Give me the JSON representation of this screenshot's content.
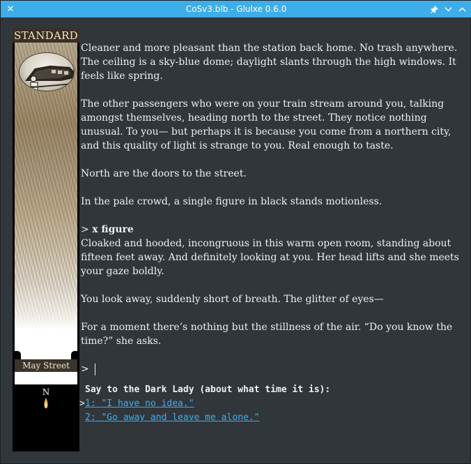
{
  "window": {
    "title": "CoSv3.blb - Glulxe 0.6.0"
  },
  "titlebar_icons": {
    "close": "close-icon",
    "pin": "pin-icon",
    "minimize": "chevron-down-icon",
    "maximize": "chevron-up-icon"
  },
  "sidebar": {
    "header": "STANDARD",
    "location": "May Street",
    "compass_label": "N"
  },
  "story": {
    "paragraphs": [
      "Cleaner and more pleasant than the station back home. No trash anywhere. The ceiling is a sky-blue dome; daylight slants through the high windows. It feels like spring.",
      "The other passengers who were on your train stream around you, talking amongst themselves, heading north to the street. They notice nothing unusual. To you— but perhaps it is because you come from a northern city, and this quality of light is strange to you. Real enough to taste.",
      "North are the doors to the street.",
      "In the pale crowd, a single figure in black stands motionless."
    ],
    "command_prompt": ">",
    "command": "x figure",
    "response_paragraphs": [
      "Cloaked and hooded, incongruous in this warm open room, standing about fifteen feet away. And definitely looking at you. Her head lifts and she meets your gaze boldly.",
      "You look away, suddenly short of breath. The glitter of eyes—",
      "For a moment there’s nothing but the stillness of the air. “Do you know the time?” she asks."
    ],
    "input_prompt": ">"
  },
  "menu": {
    "heading": "Say to the Dark Lady (about what time it is):",
    "marker": ">",
    "options": [
      "1: \"I have no idea.\"",
      "2: \"Go away and leave me alone.\""
    ]
  },
  "colors": {
    "titlebar": "#3daee9",
    "background": "#31363b",
    "link": "#3daee9",
    "text": "#eff0f1"
  }
}
